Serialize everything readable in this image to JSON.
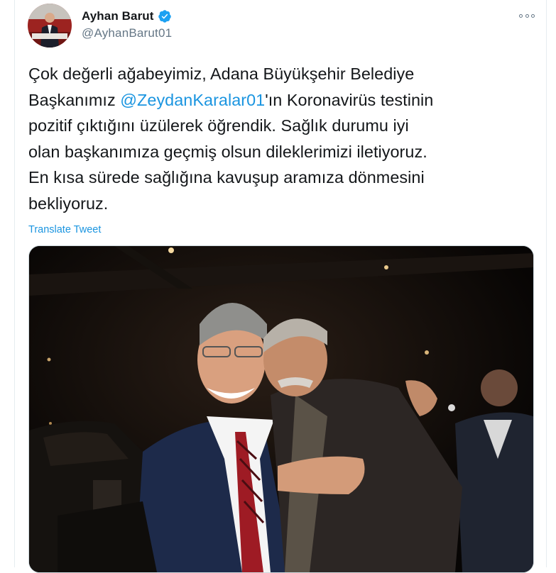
{
  "user": {
    "display_name": "Ayhan Barut",
    "handle": "@AyhanBarut01",
    "verified": true
  },
  "tweet": {
    "lines": [
      {
        "before": "Çok değerli ağabeyimiz, Adana Büyükşehir Belediye",
        "mention": "",
        "after": ""
      },
      {
        "before": "Başkanımız ",
        "mention": "@ZeydanKaralar01",
        "after": "'ın Koronavirüs testinin"
      },
      {
        "before": "pozitif çıktığını üzülerek öğrendik. Sağlık durumu iyi",
        "mention": "",
        "after": ""
      },
      {
        "before": "olan başkanımıza geçmiş olsun dileklerimizi iletiyoruz.",
        "mention": "",
        "after": ""
      },
      {
        "before": "En kısa sürede sağlığına kavuşup aramıza dönmesini",
        "mention": "",
        "after": ""
      },
      {
        "before": "bekliyoruz.",
        "mention": "",
        "after": ""
      }
    ],
    "translate_label": "Translate Tweet"
  },
  "colors": {
    "link": "#1b95e0",
    "text": "#14171a",
    "secondary": "#657786",
    "verified": "#1da1f2"
  },
  "icons": {
    "verified": "verified-badge-icon",
    "more": "more-options-icon"
  }
}
